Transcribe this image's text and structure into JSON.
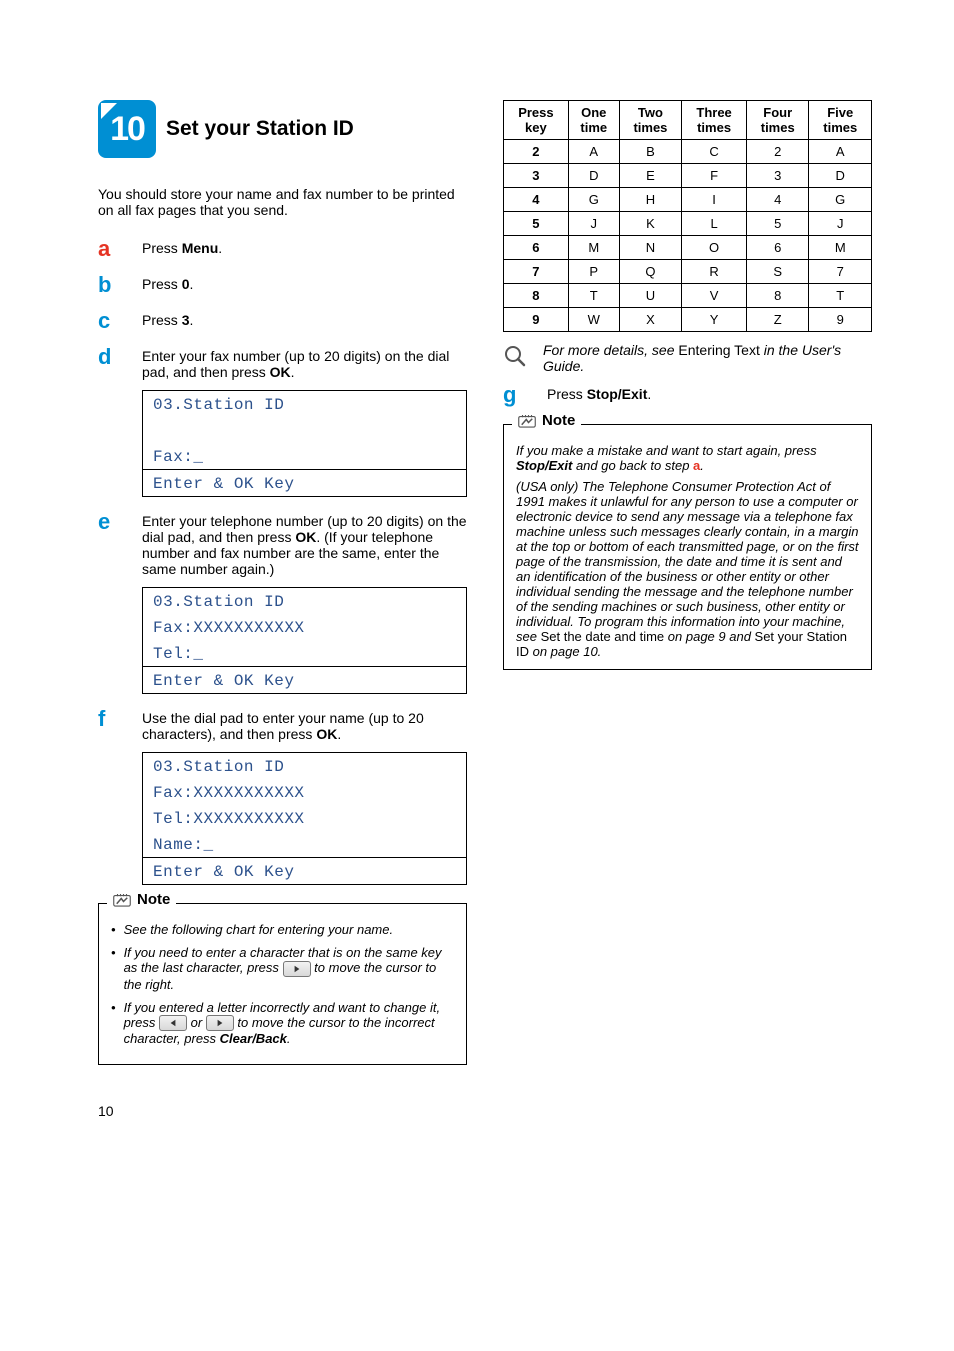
{
  "pageNumber": "10",
  "step": {
    "number": "10",
    "title": "Set your Station ID"
  },
  "intro": "You should store your name and fax number to be printed on all fax pages that you send.",
  "substeps": {
    "a": [
      "Press ",
      "Menu",
      "."
    ],
    "b": [
      "Press ",
      "0",
      "."
    ],
    "c": [
      "Press ",
      "3",
      "."
    ],
    "d": "Enter your fax number (up to 20 digits) on the dial pad, and then press ",
    "d_em": "OK",
    "e": "Enter your telephone number (up to 20 digits) on the dial pad, and then press ",
    "e_em": "OK",
    "e_tail": ". (If your telephone number and fax number are the same, enter the same number again.)",
    "f": "Use the dial pad to enter your name (up to 20 characters), and then press ",
    "f_em": "OK",
    "g": [
      "Press ",
      "Stop/Exit",
      "."
    ]
  },
  "lcd1": {
    "l1": "03.Station ID",
    "l2": "",
    "l3": " Fax:_",
    "l4": "Enter & OK Key"
  },
  "lcd2": {
    "l1": "03.Station ID",
    "l2": " Fax:XXXXXXXXXXX",
    "l3": " Tel:_",
    "l4": "Enter & OK Key"
  },
  "lcd3": {
    "l1": "03.Station ID",
    "l2": " Fax:XXXXXXXXXXX",
    "l3": " Tel:XXXXXXXXXXX",
    "l4": " Name:_",
    "l5": "Enter & OK Key"
  },
  "note_label": "Note",
  "note1": {
    "li1": "See the following chart for entering your name.",
    "li2a": "If you need to enter a character that is on the same key as the last character, press ",
    "li2b": " to move the cursor to the right.",
    "li3a": "If you entered a letter incorrectly and want to change it, press ",
    "li3or": " or ",
    "li3b": " to move the cursor to the incorrect character, press ",
    "li3em": "Clear/Back",
    "li3c": "."
  },
  "keytable": {
    "headers": [
      "Press key",
      "One time",
      "Two times",
      "Three times",
      "Four times",
      "Five times"
    ],
    "rows": [
      [
        "2",
        "A",
        "B",
        "C",
        "2",
        "A"
      ],
      [
        "3",
        "D",
        "E",
        "F",
        "3",
        "D"
      ],
      [
        "4",
        "G",
        "H",
        "I",
        "4",
        "G"
      ],
      [
        "5",
        "J",
        "K",
        "L",
        "5",
        "J"
      ],
      [
        "6",
        "M",
        "N",
        "O",
        "6",
        "M"
      ],
      [
        "7",
        "P",
        "Q",
        "R",
        "S",
        "7"
      ],
      [
        "8",
        "T",
        "U",
        "V",
        "8",
        "T"
      ],
      [
        "9",
        "W",
        "X",
        "Y",
        "Z",
        "9"
      ]
    ]
  },
  "info": {
    "pre": "For more details, see ",
    "ns": "Entering Text",
    "post": " in the User's Guide."
  },
  "note2": {
    "p1a": "If you make a mistake and want to start again, press ",
    "p1b": "Stop/Exit",
    "p1c": " and go back to step ",
    "p1d": "a",
    "p1e": ".",
    "p2a": "(USA only) The Telephone Consumer Protection Act of 1991 makes it unlawful for any person to use a computer or electronic device to send any message via a telephone fax machine unless such messages clearly contain, in a margin at the top or bottom of each transmitted page, or on the first page of the transmission, the date and time it is sent and an identification of the business or other entity or other individual sending the message and the telephone number of the sending machines or such business, other entity or individual. To program this information into your machine, see ",
    "p2ns1": "Set the date and time",
    "p2b": " on page 9 and ",
    "p2ns2": "Set your Station ID",
    "p2c": " on page 10."
  }
}
